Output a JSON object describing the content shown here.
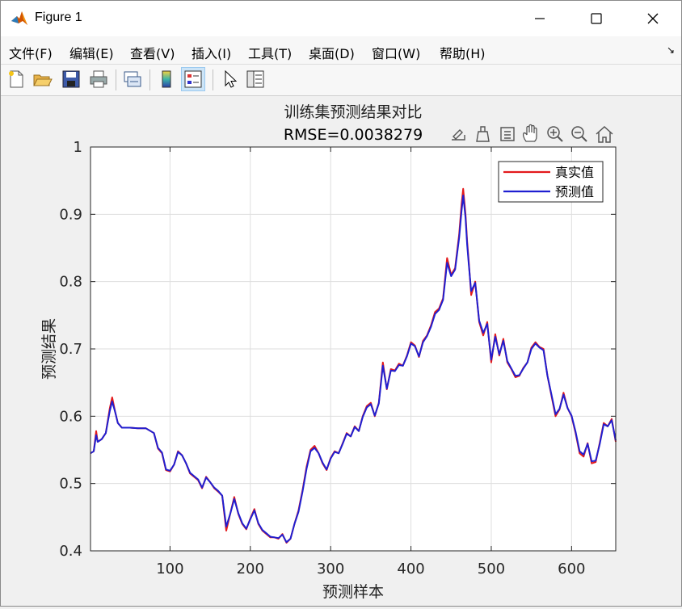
{
  "window": {
    "title": "Figure 1"
  },
  "menu": [
    "文件(F)",
    "编辑(E)",
    "查看(V)",
    "插入(I)",
    "工具(T)",
    "桌面(D)",
    "窗口(W)",
    "帮助(H)"
  ],
  "toolbar": {
    "buttons": [
      "new-figure-icon",
      "open-icon",
      "save-icon",
      "print-icon",
      "link-figure-icon",
      "colorbar-icon",
      "legend-icon",
      "pointer-icon",
      "property-inspector-icon"
    ]
  },
  "axes_toolbar": [
    "export-icon",
    "brush-icon",
    "data-tips-icon",
    "pan-icon",
    "zoom-in-icon",
    "zoom-out-icon",
    "home-icon"
  ],
  "colors": {
    "true_series": "#e31a1c",
    "pred_series": "#1f1fd1",
    "grid": "#dedede"
  },
  "chart_data": {
    "type": "line",
    "title": "训练集预测结果对比",
    "subtitle": "RMSE=0.0038279",
    "xlabel": "预测样本",
    "ylabel": "预测结果",
    "xlim": [
      1,
      655
    ],
    "ylim": [
      0.4,
      1.0
    ],
    "xticks": [
      100,
      200,
      300,
      400,
      500,
      600
    ],
    "yticks": [
      0.4,
      0.5,
      0.6,
      0.7,
      0.8,
      0.9,
      1
    ],
    "ytick_labels": [
      "0.4",
      "0.5",
      "0.6",
      "0.7",
      "0.8",
      "0.9",
      "1"
    ],
    "grid": true,
    "legend_position": "top-right",
    "series": [
      {
        "name": "真实值",
        "x": [
          1,
          5,
          8,
          10,
          15,
          20,
          25,
          28,
          32,
          35,
          40,
          50,
          60,
          70,
          80,
          85,
          90,
          95,
          100,
          105,
          110,
          115,
          120,
          125,
          130,
          135,
          140,
          145,
          150,
          155,
          160,
          165,
          170,
          175,
          180,
          185,
          190,
          195,
          200,
          205,
          210,
          215,
          220,
          225,
          230,
          235,
          240,
          245,
          250,
          255,
          260,
          265,
          270,
          275,
          280,
          285,
          290,
          295,
          300,
          305,
          310,
          315,
          320,
          325,
          330,
          335,
          340,
          345,
          350,
          355,
          360,
          365,
          370,
          375,
          380,
          385,
          390,
          395,
          400,
          405,
          410,
          415,
          420,
          425,
          430,
          435,
          440,
          445,
          450,
          455,
          460,
          463,
          465,
          468,
          470,
          472,
          475,
          480,
          485,
          490,
          495,
          500,
          505,
          510,
          515,
          520,
          525,
          530,
          535,
          540,
          545,
          550,
          555,
          560,
          565,
          570,
          575,
          580,
          585,
          590,
          595,
          600,
          605,
          610,
          615,
          620,
          625,
          630,
          635,
          640,
          645,
          650,
          655
        ],
        "y": [
          0.545,
          0.548,
          0.578,
          0.562,
          0.566,
          0.575,
          0.612,
          0.628,
          0.605,
          0.59,
          0.583,
          0.583,
          0.582,
          0.582,
          0.575,
          0.552,
          0.545,
          0.52,
          0.518,
          0.528,
          0.548,
          0.542,
          0.53,
          0.515,
          0.51,
          0.505,
          0.493,
          0.51,
          0.502,
          0.493,
          0.488,
          0.482,
          0.43,
          0.455,
          0.48,
          0.455,
          0.44,
          0.432,
          0.448,
          0.462,
          0.44,
          0.43,
          0.425,
          0.42,
          0.42,
          0.418,
          0.425,
          0.412,
          0.418,
          0.44,
          0.46,
          0.49,
          0.525,
          0.55,
          0.556,
          0.545,
          0.53,
          0.52,
          0.538,
          0.548,
          0.545,
          0.56,
          0.575,
          0.57,
          0.585,
          0.578,
          0.6,
          0.615,
          0.62,
          0.6,
          0.62,
          0.68,
          0.64,
          0.67,
          0.668,
          0.678,
          0.675,
          0.69,
          0.71,
          0.705,
          0.688,
          0.712,
          0.72,
          0.735,
          0.755,
          0.76,
          0.775,
          0.835,
          0.81,
          0.82,
          0.87,
          0.915,
          0.938,
          0.9,
          0.86,
          0.83,
          0.78,
          0.8,
          0.74,
          0.72,
          0.74,
          0.68,
          0.722,
          0.69,
          0.715,
          0.68,
          0.67,
          0.658,
          0.66,
          0.672,
          0.68,
          0.702,
          0.71,
          0.703,
          0.7,
          0.66,
          0.63,
          0.6,
          0.61,
          0.635,
          0.612,
          0.6,
          0.575,
          0.545,
          0.54,
          0.56,
          0.53,
          0.532,
          0.56,
          0.59,
          0.585,
          0.596,
          0.562
        ]
      },
      {
        "name": "预测值",
        "x": [
          1,
          5,
          8,
          10,
          15,
          20,
          25,
          28,
          32,
          35,
          40,
          50,
          60,
          70,
          80,
          85,
          90,
          95,
          100,
          105,
          110,
          115,
          120,
          125,
          130,
          135,
          140,
          145,
          150,
          155,
          160,
          165,
          170,
          175,
          180,
          185,
          190,
          195,
          200,
          205,
          210,
          215,
          220,
          225,
          230,
          235,
          240,
          245,
          250,
          255,
          260,
          265,
          270,
          275,
          280,
          285,
          290,
          295,
          300,
          305,
          310,
          315,
          320,
          325,
          330,
          335,
          340,
          345,
          350,
          355,
          360,
          365,
          370,
          375,
          380,
          385,
          390,
          395,
          400,
          405,
          410,
          415,
          420,
          425,
          430,
          435,
          440,
          445,
          450,
          455,
          460,
          463,
          465,
          468,
          470,
          472,
          475,
          480,
          485,
          490,
          495,
          500,
          505,
          510,
          515,
          520,
          525,
          530,
          535,
          540,
          545,
          550,
          555,
          560,
          565,
          570,
          575,
          580,
          585,
          590,
          595,
          600,
          605,
          610,
          615,
          620,
          625,
          630,
          635,
          640,
          645,
          650,
          655
        ],
        "y": [
          0.545,
          0.548,
          0.572,
          0.562,
          0.566,
          0.575,
          0.608,
          0.622,
          0.605,
          0.59,
          0.583,
          0.583,
          0.582,
          0.582,
          0.575,
          0.553,
          0.546,
          0.521,
          0.519,
          0.528,
          0.547,
          0.542,
          0.53,
          0.516,
          0.511,
          0.506,
          0.494,
          0.509,
          0.502,
          0.494,
          0.489,
          0.482,
          0.436,
          0.455,
          0.477,
          0.456,
          0.441,
          0.433,
          0.447,
          0.46,
          0.441,
          0.431,
          0.426,
          0.421,
          0.42,
          0.419,
          0.424,
          0.413,
          0.418,
          0.44,
          0.458,
          0.488,
          0.522,
          0.548,
          0.553,
          0.545,
          0.531,
          0.521,
          0.537,
          0.547,
          0.545,
          0.559,
          0.574,
          0.57,
          0.584,
          0.578,
          0.599,
          0.613,
          0.618,
          0.601,
          0.619,
          0.675,
          0.641,
          0.668,
          0.667,
          0.676,
          0.675,
          0.689,
          0.708,
          0.704,
          0.689,
          0.71,
          0.719,
          0.733,
          0.752,
          0.758,
          0.773,
          0.828,
          0.808,
          0.818,
          0.865,
          0.905,
          0.928,
          0.895,
          0.855,
          0.826,
          0.786,
          0.798,
          0.742,
          0.724,
          0.737,
          0.684,
          0.718,
          0.692,
          0.712,
          0.682,
          0.671,
          0.66,
          0.661,
          0.671,
          0.68,
          0.7,
          0.708,
          0.702,
          0.698,
          0.66,
          0.632,
          0.603,
          0.611,
          0.632,
          0.612,
          0.601,
          0.577,
          0.548,
          0.543,
          0.559,
          0.533,
          0.534,
          0.558,
          0.588,
          0.585,
          0.594,
          0.564
        ]
      }
    ]
  }
}
